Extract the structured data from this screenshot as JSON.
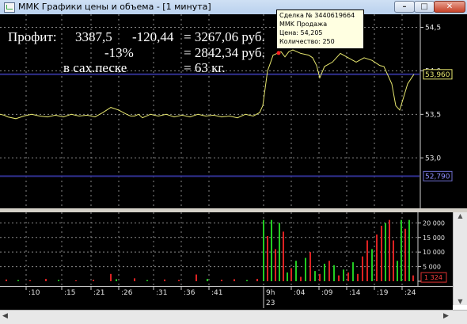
{
  "window": {
    "title": "MMK Графики цены и объема - [1 минута]",
    "icons": {
      "app": "chart-app-icon",
      "minimize": "minimize-icon",
      "maximize": "maximize-icon",
      "close": "close-icon"
    }
  },
  "annotations": {
    "row1": {
      "label": "Профит:",
      "a": "3387,5",
      "b": "-120,44",
      "result": "= 3267,06 руб."
    },
    "row2": {
      "pct": "-13%",
      "result": "= 2842,34 руб."
    },
    "row3": {
      "label": "в сах.песке",
      "result": "= 63 кг."
    }
  },
  "tooltip": {
    "line1": "Сделка № 3440619664",
    "line2": "MMK Продажа",
    "line3": "Цена: 54,205",
    "line4": "Количество: 250"
  },
  "price_axis": {
    "ticks": [
      "54,5",
      "54,0",
      "53,5",
      "53,0"
    ],
    "current_price": "53,960",
    "marker_price": "52,790"
  },
  "volume_axis": {
    "ticks": [
      "20 000",
      "15 000",
      "10 000",
      "5 000",
      "0"
    ],
    "last_volume": "1 324"
  },
  "time_axis": {
    "labels": [
      ":10",
      ":15",
      ":21",
      ":26",
      ":31",
      ":36",
      ":41",
      "9h",
      ":04",
      ":09",
      ":14",
      ":19",
      ":24"
    ],
    "date": "23"
  },
  "colors": {
    "price_line": "#e6e66e",
    "level_line": "#303090",
    "up_bar": "#22cc22",
    "down_bar": "#dd2222",
    "grid": "#8a8a8a",
    "background": "#000000"
  },
  "chart_data": {
    "type": "line",
    "title": "",
    "price_series": {
      "x": [
        0,
        5,
        10,
        20,
        30,
        40,
        50,
        60,
        70,
        80,
        90,
        100,
        110,
        120,
        130,
        140,
        150,
        160,
        165,
        170,
        175,
        180,
        190,
        200,
        210,
        220,
        230,
        240,
        250,
        260,
        270,
        280,
        290,
        300,
        310,
        320,
        328,
        332,
        335,
        338,
        342,
        345,
        350,
        355,
        360,
        365,
        370,
        380,
        390,
        395,
        400,
        404,
        410,
        420,
        430,
        440,
        450,
        460,
        470,
        480,
        485,
        490,
        495,
        500,
        505,
        510,
        515,
        520,
        523
      ],
      "y": [
        53.5,
        53.49,
        53.47,
        53.45,
        53.48,
        53.5,
        53.48,
        53.47,
        53.49,
        53.47,
        53.5,
        53.48,
        53.49,
        53.47,
        53.52,
        53.58,
        53.55,
        53.5,
        53.48,
        53.48,
        53.5,
        53.46,
        53.5,
        53.48,
        53.5,
        53.47,
        53.49,
        53.47,
        53.5,
        53.48,
        53.49,
        53.47,
        53.48,
        53.46,
        53.5,
        53.48,
        53.52,
        53.6,
        53.8,
        54.0,
        54.1,
        54.18,
        54.2,
        54.22,
        54.16,
        54.22,
        54.24,
        54.2,
        54.18,
        54.15,
        54.06,
        53.92,
        54.05,
        54.1,
        54.2,
        54.15,
        54.1,
        54.15,
        54.12,
        54.06,
        54.05,
        53.95,
        53.85,
        53.6,
        53.55,
        53.7,
        53.85,
        53.92,
        53.96
      ],
      "ylim": [
        52.42,
        54.65
      ],
      "level_lines": [
        53.96,
        52.79
      ]
    },
    "volume_series": {
      "ylim": [
        0,
        22000
      ],
      "bars": [
        {
          "x": 8,
          "v": 600,
          "dir": "down"
        },
        {
          "x": 23,
          "v": 400,
          "dir": "up"
        },
        {
          "x": 38,
          "v": 350,
          "dir": "down"
        },
        {
          "x": 58,
          "v": 800,
          "dir": "down"
        },
        {
          "x": 74,
          "v": 450,
          "dir": "up"
        },
        {
          "x": 96,
          "v": 300,
          "dir": "down"
        },
        {
          "x": 118,
          "v": 500,
          "dir": "down"
        },
        {
          "x": 140,
          "v": 2500,
          "dir": "down"
        },
        {
          "x": 147,
          "v": 700,
          "dir": "up"
        },
        {
          "x": 170,
          "v": 1000,
          "dir": "down"
        },
        {
          "x": 186,
          "v": 400,
          "dir": "up"
        },
        {
          "x": 208,
          "v": 600,
          "dir": "down"
        },
        {
          "x": 226,
          "v": 450,
          "dir": "down"
        },
        {
          "x": 248,
          "v": 2300,
          "dir": "down"
        },
        {
          "x": 262,
          "v": 800,
          "dir": "up"
        },
        {
          "x": 280,
          "v": 500,
          "dir": "down"
        },
        {
          "x": 296,
          "v": 700,
          "dir": "down"
        },
        {
          "x": 312,
          "v": 400,
          "dir": "up"
        },
        {
          "x": 325,
          "v": 800,
          "dir": "down"
        },
        {
          "x": 333,
          "v": 21000,
          "dir": "up"
        },
        {
          "x": 338,
          "v": 15500,
          "dir": "down"
        },
        {
          "x": 343,
          "v": 21000,
          "dir": "up"
        },
        {
          "x": 348,
          "v": 11000,
          "dir": "down"
        },
        {
          "x": 353,
          "v": 20000,
          "dir": "up"
        },
        {
          "x": 358,
          "v": 17000,
          "dir": "down"
        },
        {
          "x": 363,
          "v": 3000,
          "dir": "up"
        },
        {
          "x": 368,
          "v": 4500,
          "dir": "down"
        },
        {
          "x": 374,
          "v": 7000,
          "dir": "up"
        },
        {
          "x": 380,
          "v": 1500,
          "dir": "down"
        },
        {
          "x": 386,
          "v": 8000,
          "dir": "up"
        },
        {
          "x": 392,
          "v": 10000,
          "dir": "down"
        },
        {
          "x": 398,
          "v": 3500,
          "dir": "up"
        },
        {
          "x": 404,
          "v": 2500,
          "dir": "down"
        },
        {
          "x": 410,
          "v": 6000,
          "dir": "up"
        },
        {
          "x": 416,
          "v": 7000,
          "dir": "down"
        },
        {
          "x": 422,
          "v": 5500,
          "dir": "up"
        },
        {
          "x": 428,
          "v": 2000,
          "dir": "down"
        },
        {
          "x": 434,
          "v": 4000,
          "dir": "up"
        },
        {
          "x": 440,
          "v": 3000,
          "dir": "down"
        },
        {
          "x": 446,
          "v": 6500,
          "dir": "up"
        },
        {
          "x": 452,
          "v": 2500,
          "dir": "down"
        },
        {
          "x": 458,
          "v": 8500,
          "dir": "down"
        },
        {
          "x": 464,
          "v": 14000,
          "dir": "down"
        },
        {
          "x": 470,
          "v": 11000,
          "dir": "up"
        },
        {
          "x": 476,
          "v": 16000,
          "dir": "down"
        },
        {
          "x": 482,
          "v": 19000,
          "dir": "down"
        },
        {
          "x": 487,
          "v": 20000,
          "dir": "up"
        },
        {
          "x": 492,
          "v": 21000,
          "dir": "down"
        },
        {
          "x": 497,
          "v": 14000,
          "dir": "down"
        },
        {
          "x": 502,
          "v": 7000,
          "dir": "up"
        },
        {
          "x": 507,
          "v": 21000,
          "dir": "up"
        },
        {
          "x": 512,
          "v": 18000,
          "dir": "down"
        },
        {
          "x": 517,
          "v": 21000,
          "dir": "up"
        },
        {
          "x": 522,
          "v": 2000,
          "dir": "down"
        }
      ]
    }
  }
}
